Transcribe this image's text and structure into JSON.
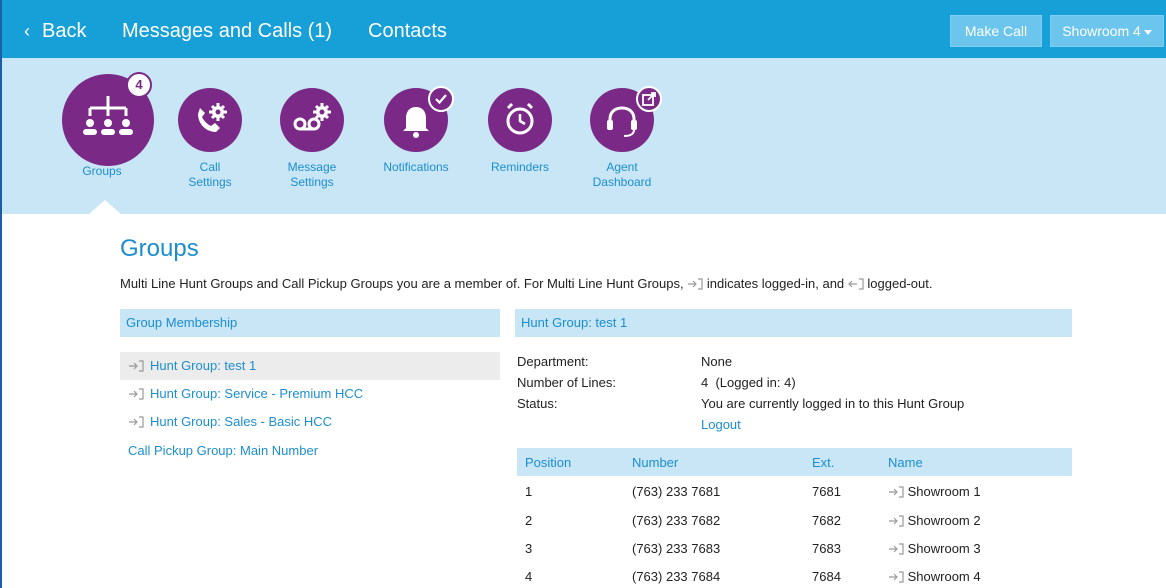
{
  "topbar": {
    "back_label": "Back",
    "tab_messages": "Messages and Calls (1)",
    "tab_contacts": "Contacts",
    "make_call_label": "Make Call",
    "showroom_label": "Showroom 4"
  },
  "icons": [
    {
      "label": "Groups",
      "badge": "4"
    },
    {
      "label_line1": "Call",
      "label_line2": "Settings"
    },
    {
      "label_line1": "Message",
      "label_line2": "Settings"
    },
    {
      "label": "Notifications"
    },
    {
      "label": "Reminders"
    },
    {
      "label_line1": "Agent",
      "label_line2": "Dashboard"
    }
  ],
  "colors": {
    "topbar": "#179fd8",
    "band": "#c8e6f5",
    "icon_circle": "#7a2a86",
    "link": "#1c8ed0"
  },
  "page": {
    "title": "Groups",
    "intro_part1": "Multi Line Hunt Groups and Call Pickup Groups you are a member of. For Multi Line Hunt Groups,",
    "intro_part2": "indicates logged-in, and",
    "intro_part3": "logged-out."
  },
  "membership": {
    "header": "Group Membership",
    "items": [
      {
        "label": "Hunt Group: test 1",
        "selected": true
      },
      {
        "label": "Hunt Group: Service - Premium HCC"
      },
      {
        "label": "Hunt Group: Sales - Basic HCC"
      },
      {
        "label": "Call Pickup Group: Main Number"
      }
    ]
  },
  "detail": {
    "header": "Hunt Group: test 1",
    "department_label": "Department:",
    "department_value": "None",
    "lines_label": "Number of Lines:",
    "lines_value": "4  (Logged in: 4)",
    "status_label": "Status:",
    "status_value": "You are currently logged in to this Hunt Group",
    "logout_label": "Logout"
  },
  "table": {
    "headers": {
      "position": "Position",
      "number": "Number",
      "ext": "Ext.",
      "name": "Name"
    },
    "rows": [
      {
        "position": "1",
        "number": "(763) 233 7681",
        "ext": "7681",
        "name": "Showroom 1"
      },
      {
        "position": "2",
        "number": "(763) 233 7682",
        "ext": "7682",
        "name": "Showroom 2"
      },
      {
        "position": "3",
        "number": "(763) 233 7683",
        "ext": "7683",
        "name": "Showroom 3"
      },
      {
        "position": "4",
        "number": "(763) 233 7684",
        "ext": "7684",
        "name": "Showroom 4"
      }
    ]
  }
}
